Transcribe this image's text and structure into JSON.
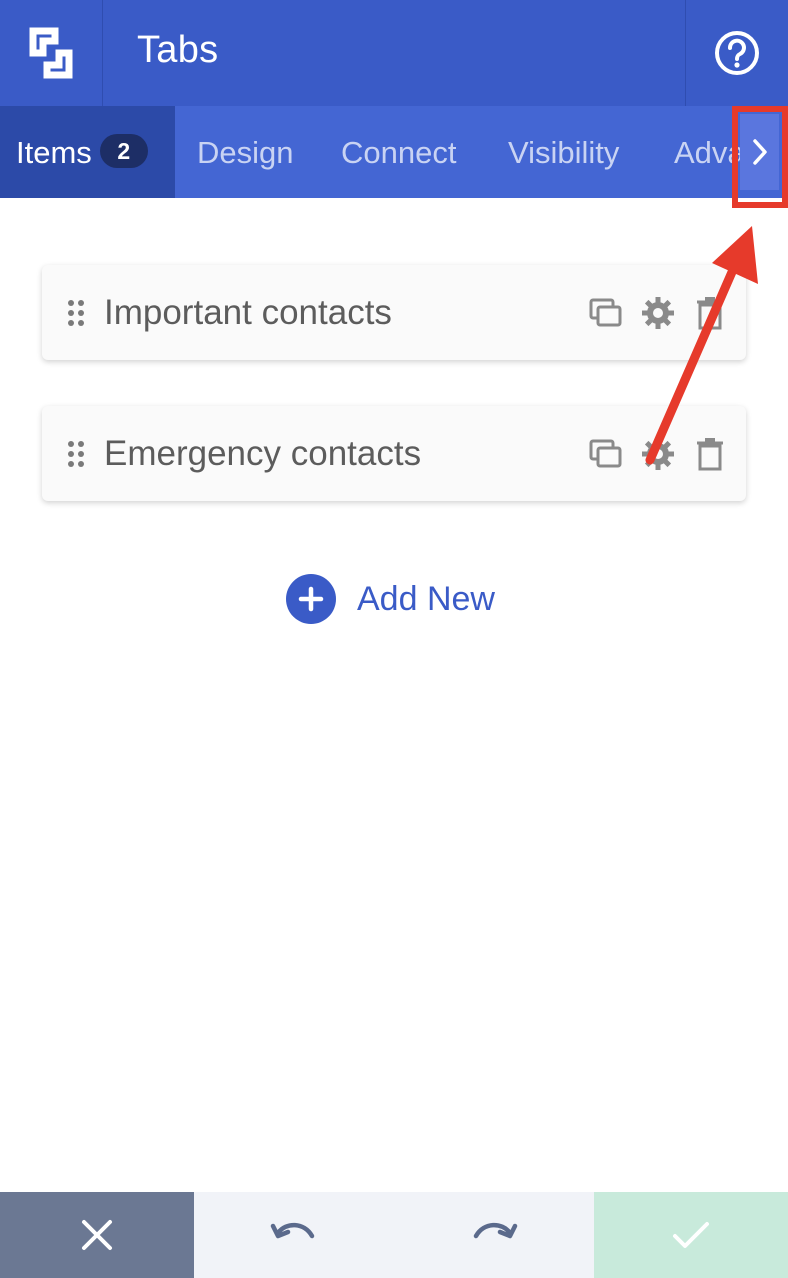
{
  "header": {
    "title": "Tabs",
    "logo_icon": "builder-logo-icon",
    "help_icon": "help-circle-icon"
  },
  "tabs": [
    {
      "label": "Items",
      "badge": "2",
      "active": true
    },
    {
      "label": "Design",
      "active": false
    },
    {
      "label": "Connect",
      "active": false
    },
    {
      "label": "Visibility",
      "active": false
    },
    {
      "label": "Adva",
      "active": false
    }
  ],
  "tab_scroll_icon": "chevron-right-icon",
  "items": [
    {
      "label": "Important contacts"
    },
    {
      "label": "Emergency contacts"
    }
  ],
  "item_actions": [
    "duplicate-icon",
    "gear-icon",
    "trash-icon"
  ],
  "add_new": {
    "label": "Add New",
    "icon": "plus-icon"
  },
  "footer": {
    "buttons": [
      "close-icon",
      "undo-icon",
      "redo-icon",
      "check-icon"
    ]
  },
  "colors": {
    "header": "#3a5bc7",
    "tabbar": "#4466d3",
    "active_tab": "#2c4aa8",
    "annotation": "#e63a2b",
    "cancel": "#6b7893",
    "confirm": "#c8eadb"
  }
}
